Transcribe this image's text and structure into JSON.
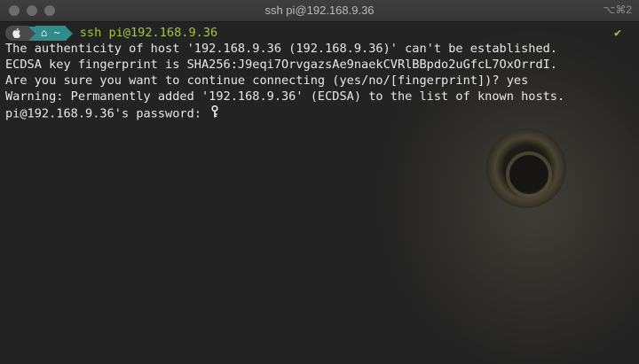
{
  "window": {
    "title": "ssh pi@192.168.9.36",
    "shortcut": "⌥⌘2"
  },
  "prompt": {
    "apple_glyph": "",
    "home_glyph": "⌂",
    "dir": "~",
    "command": "ssh pi@192.168.9.36",
    "status_check": "✔"
  },
  "output": {
    "line1": "The authenticity of host '192.168.9.36 (192.168.9.36)' can't be established.",
    "line2": "ECDSA key fingerprint is SHA256:J9eqi7OrvgazsAe9naekCVRlBBpdo2uGfcL7OxOrrdI.",
    "line3": "Are you sure you want to continue connecting (yes/no/[fingerprint])? yes",
    "line4": "Warning: Permanently added '192.168.9.36' (ECDSA) to the list of known hosts.",
    "line5": "pi@192.168.9.36's password: "
  },
  "colors": {
    "accent_green": "#a7c43b",
    "prompt_teal": "#2f8c8a",
    "text": "#e8e8e8"
  }
}
